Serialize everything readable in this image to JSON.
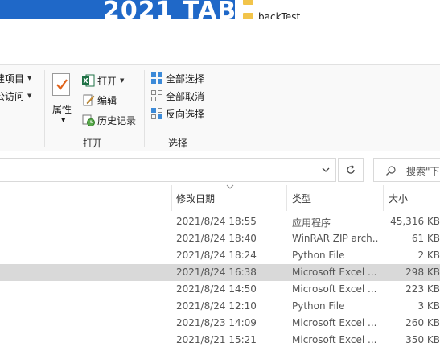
{
  "desktop": {
    "banner_text": "2021 TAB",
    "files": [
      "",
      "backTest"
    ],
    "colors": {
      "banner_bg": "#1f68c8",
      "folder": "#f2c44a"
    }
  },
  "ribbon": {
    "new_group": {
      "items": [
        {
          "label": "建项目",
          "icon": "new-item-icon"
        },
        {
          "label": "公访问",
          "icon": "easy-access-icon"
        }
      ]
    },
    "open_group": {
      "label": "打开",
      "properties_label": "属性",
      "items": [
        {
          "label": "打开",
          "icon": "excel-icon"
        },
        {
          "label": "编辑",
          "icon": "edit-icon"
        },
        {
          "label": "历史记录",
          "icon": "history-icon"
        }
      ]
    },
    "select_group": {
      "label": "选择",
      "items": [
        {
          "label": "全部选择",
          "icon": "select-all-icon"
        },
        {
          "label": "全部取消",
          "icon": "select-none-icon"
        },
        {
          "label": "反向选择",
          "icon": "invert-selection-icon"
        }
      ]
    }
  },
  "address": {
    "search_placeholder": "搜索\"下"
  },
  "columns": {
    "date": "修改日期",
    "type": "类型",
    "size": "大小"
  },
  "rows": [
    {
      "date": "2021/8/24 18:55",
      "type": "应用程序",
      "size": "45,316 KB",
      "selected": false
    },
    {
      "date": "2021/8/24 18:40",
      "type": "WinRAR ZIP arch...",
      "size": "61 KB",
      "selected": false
    },
    {
      "date": "2021/8/24 18:24",
      "type": "Python File",
      "size": "2 KB",
      "selected": false
    },
    {
      "date": "2021/8/24 16:38",
      "type": "Microsoft Excel ...",
      "size": "298 KB",
      "selected": true
    },
    {
      "date": "2021/8/24 14:50",
      "type": "Microsoft Excel ...",
      "size": "223 KB",
      "selected": false
    },
    {
      "date": "2021/8/24 12:10",
      "type": "Python File",
      "size": "3 KB",
      "selected": false
    },
    {
      "date": "2021/8/23 14:09",
      "type": "Microsoft Excel ...",
      "size": "260 KB",
      "selected": false
    },
    {
      "date": "2021/8/21 15:21",
      "type": "Microsoft Excel ...",
      "size": "350 KB",
      "selected": false
    }
  ]
}
